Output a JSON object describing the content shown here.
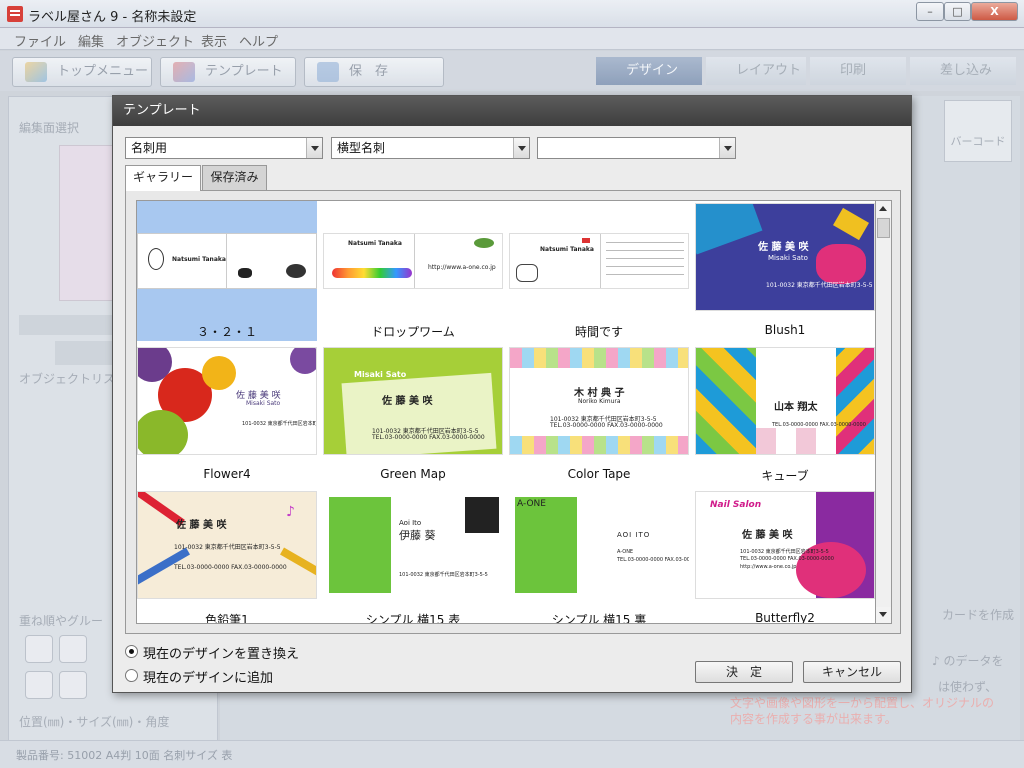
{
  "app": {
    "title": "ラベル屋さん 9 - 名称未設定",
    "window_min": "–",
    "window_max": "□",
    "window_close": "X"
  },
  "menu": [
    "ファイル",
    "編集",
    "オブジェクト",
    "表示",
    "ヘルプ"
  ],
  "toolbar": {
    "top_menu": "トップメニュー",
    "template": "テンプレート",
    "save": "保　存",
    "steps": [
      "デザイン",
      "レイアウト",
      "印刷",
      "差し込み"
    ],
    "barcode": "バーコード"
  },
  "left_panel": {
    "edit_select": "編集面選択",
    "object_list": "オブジェクトリス",
    "layer_group": "重ね順やグルー",
    "position_size": "位置(㎜)・サイズ(㎜)・角度"
  },
  "background_notes": [
    "カードを作成",
    "♪ のデータを",
    "は使わず、",
    "文字や画像や図形を一から配置し、オリジナルの",
    "内容を作成する事が出来ます。"
  ],
  "statusbar": "製品番号: 51002 A4判 10面 名刺サイズ 表",
  "dialog": {
    "title": "テンプレート",
    "combo1": "名刺用",
    "combo2": "横型名刺",
    "combo3": "",
    "tabs": [
      "ギャラリー",
      "保存済み"
    ],
    "templates": [
      {
        "name": "３・２・１",
        "selected": true
      },
      {
        "name": "ドロップワーム"
      },
      {
        "name": "時間です"
      },
      {
        "name": "Blush1"
      },
      {
        "name": "Flower4"
      },
      {
        "name": "Green Map"
      },
      {
        "name": "Color Tape"
      },
      {
        "name": "キューブ"
      },
      {
        "name": "色鉛筆1"
      },
      {
        "name": "シンプル 横15 表"
      },
      {
        "name": "シンプル 横15 裏"
      },
      {
        "name": "Butterfly2"
      }
    ],
    "card_text": {
      "natsumi": "Natsumi Tanaka",
      "misaki_jp": "佐 藤 美 咲",
      "misaki_en": "Misaki Sato",
      "noriko_jp": "木 村 典 子",
      "noriko_en": "Noriko Kimura",
      "yamamoto": "山本 翔太",
      "aoi_jp": "伊藤 葵",
      "aoi_en": "Aoi  Ito",
      "aoi_caps": "AOI   ITO",
      "a_one": "A-ONE",
      "nail": "Nail Salon",
      "address": "101-0032 東京都千代田区岩本町3-5-5",
      "tel": "TEL.03-0000-0000  FAX.03-0000-0000",
      "url": "http://www.a-one.co.jp"
    },
    "radio": [
      "現在のデザインを置き換え",
      "現在のデザインに追加"
    ],
    "ok": "決　定",
    "cancel": "キャンセル"
  }
}
